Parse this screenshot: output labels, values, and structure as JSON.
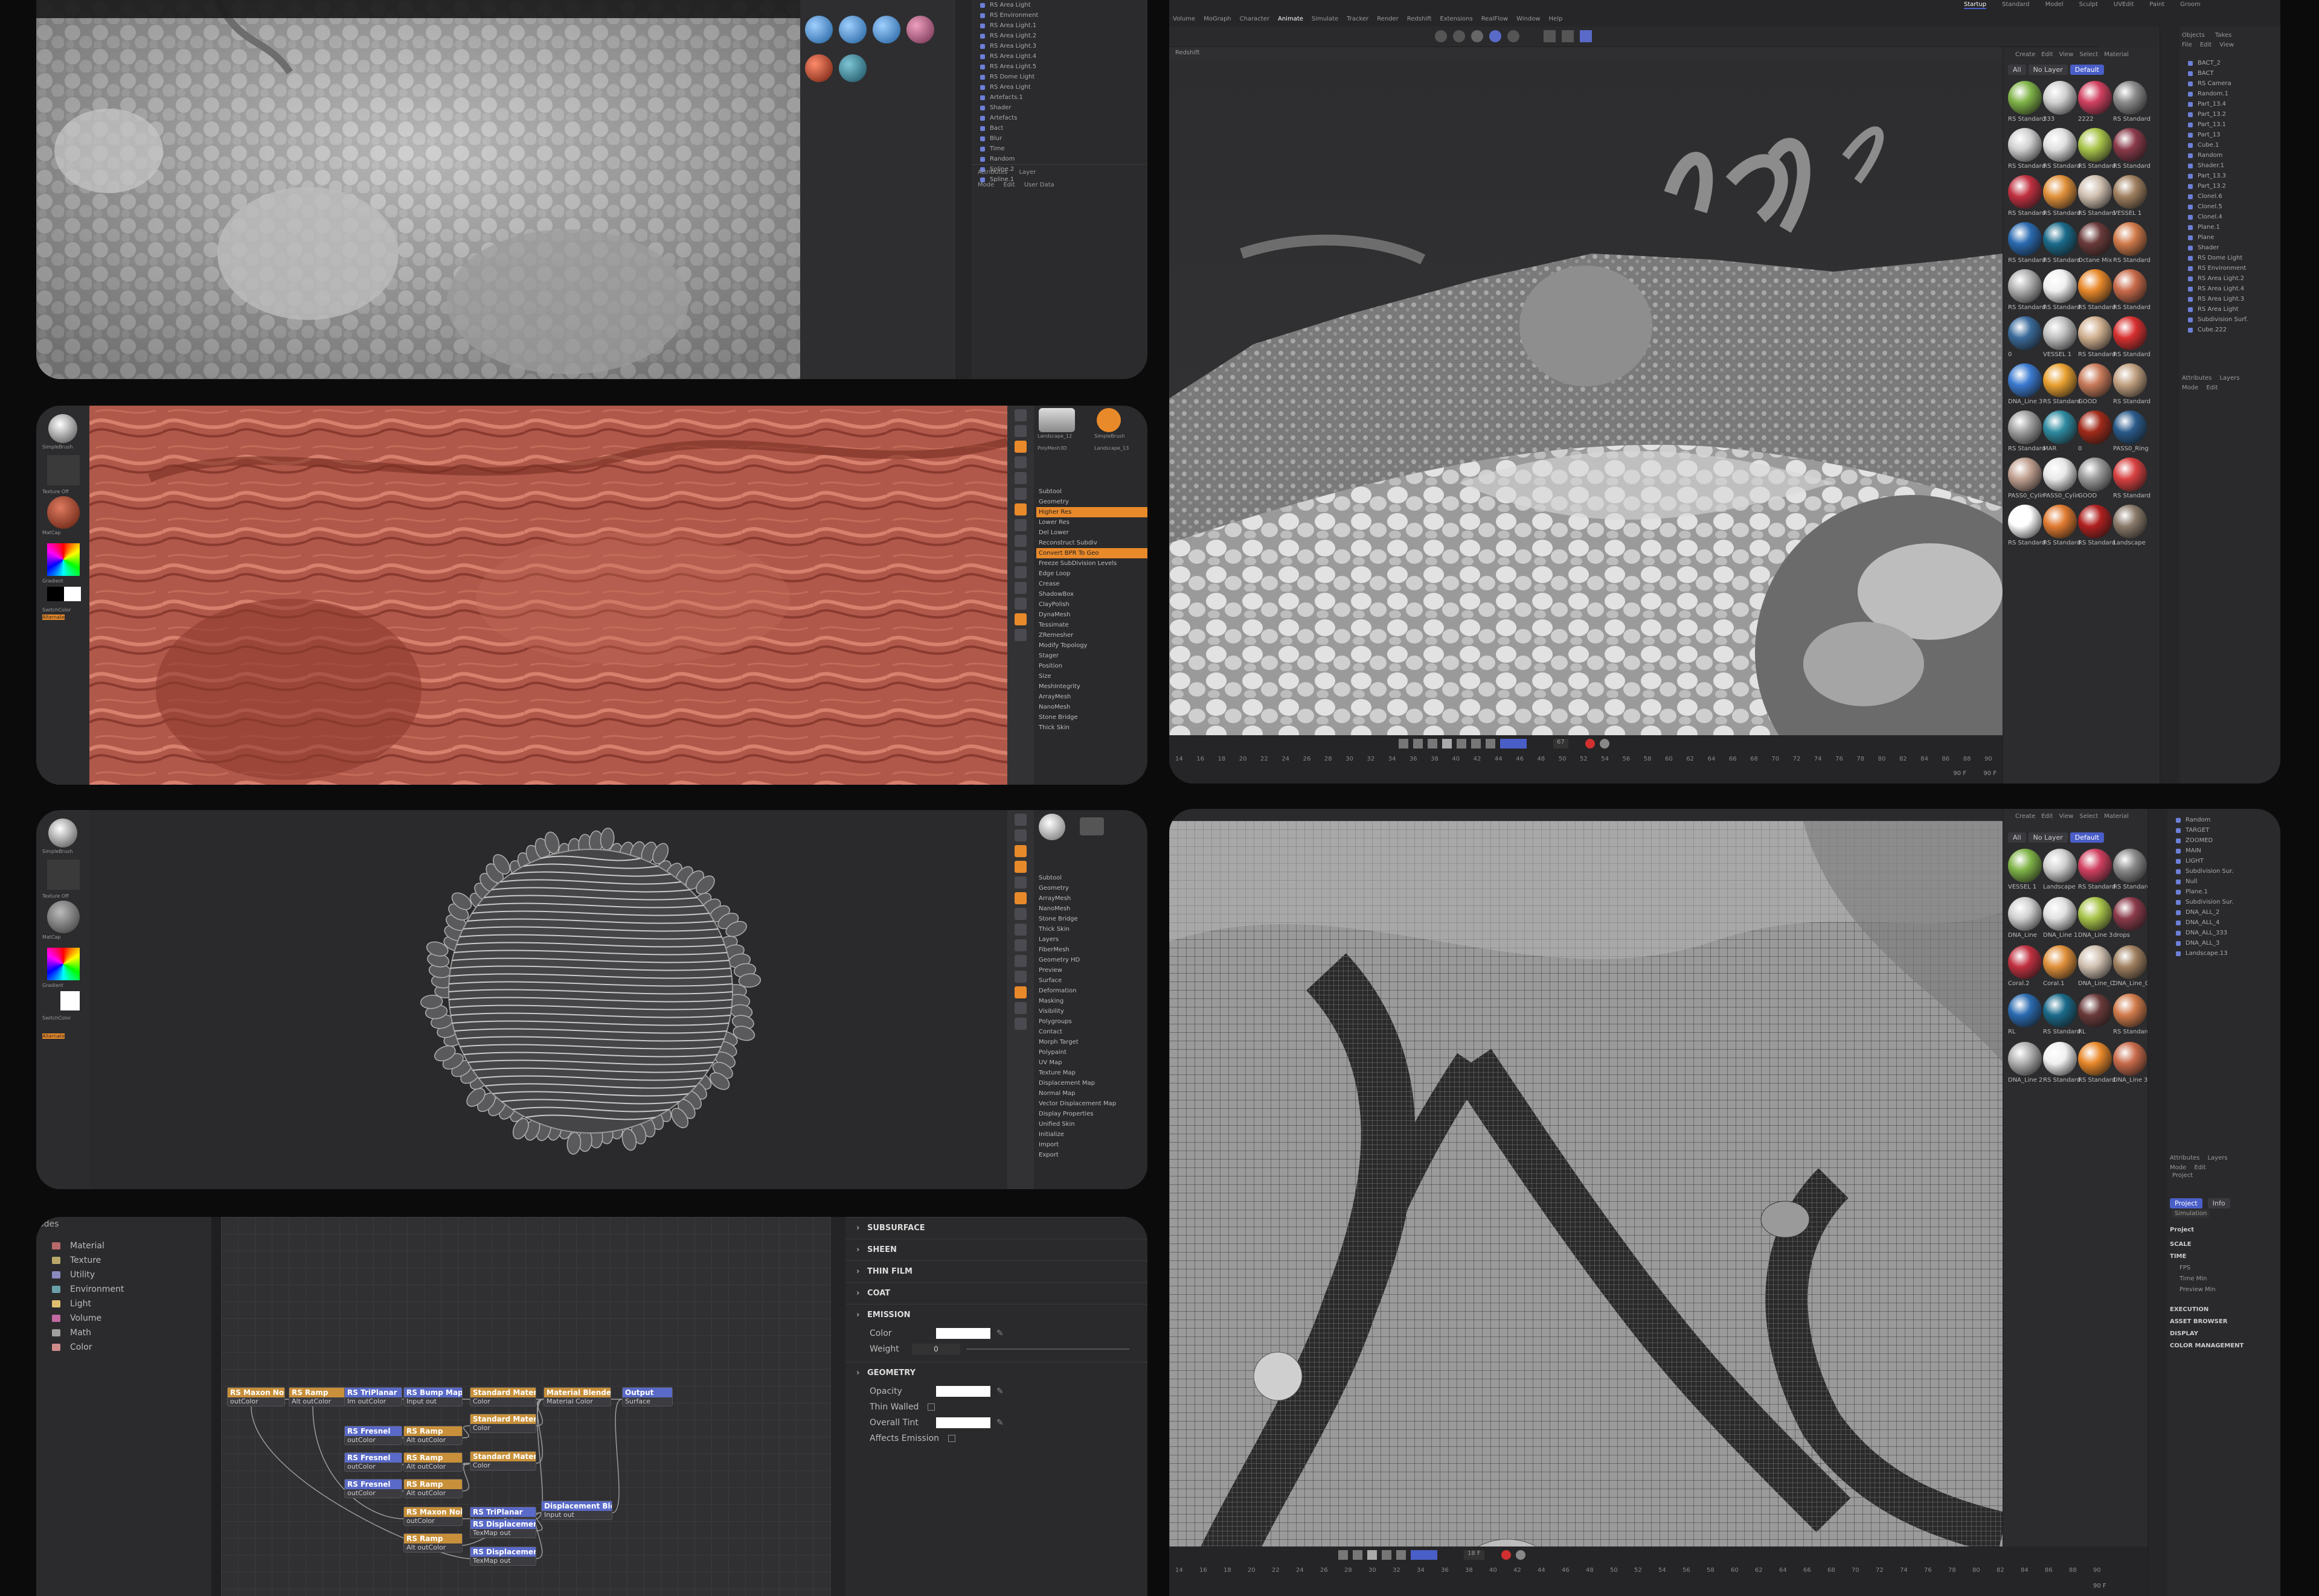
{
  "colors": {
    "accent": "#4a5ec8",
    "zbrush_orange": "#e8892a",
    "skin_red": "#b0584a",
    "viewport_gray": "#7d7d7d"
  },
  "cinema4d": {
    "menu": [
      "Volume",
      "MoGraph",
      "Character",
      "Animate",
      "Simulate",
      "Tracker",
      "Render",
      "Redshift",
      "Extensions",
      "RealFlow",
      "Window",
      "Help"
    ],
    "layouts": [
      "Startup",
      "Standard",
      "Model",
      "Sculpt",
      "UVEdit",
      "Paint",
      "Groom"
    ],
    "viewport_label": "Redshift",
    "material_menu": [
      "Create",
      "Edit",
      "View",
      "Select",
      "Material"
    ],
    "material_tabs": [
      "All",
      "No Layer",
      "Default"
    ],
    "material_labels_top": [
      "RS Standard",
      "333",
      "2222",
      "RS Standard",
      "RS Standard",
      "RS Standard",
      "RS Standard",
      "RS Standard",
      "RS Standard",
      "RS Standard",
      "RS Standard",
      "VESSEL 1",
      "RS Standard",
      "RS Standard",
      "Octane Mix",
      "RS Standard",
      "RS Standard",
      "RS Standard",
      "RS Standard",
      "RS Standard",
      "0",
      "VESSEL 1",
      "RS Standard",
      "RS Standard",
      "DNA_Line 3",
      "RS Standard",
      "GOOD",
      "RS Standard",
      "RS Standard",
      "MAR",
      "0",
      "PASS0_Ring",
      "PASS0_Cylin",
      "PASS0_Cylin",
      "GOOD",
      "RS Standard",
      "RS Standard",
      "RS Standard",
      "RS Standard",
      "Landscape"
    ],
    "objects_header": [
      "File",
      "Edit",
      "View"
    ],
    "objects_tabs": [
      "Objects",
      "Takes"
    ],
    "objects_top": [
      "BACT_2",
      "BACT",
      "RS Camera",
      "Random.1",
      "Part_13.4",
      "Part_13.2",
      "Part_13.1",
      "Part_13",
      "Cube.1",
      "Random",
      "Shader.1",
      "Part_13.3",
      "Part_13.2",
      "Clonel.6",
      "Clonel.5",
      "Clonel.4",
      "Plane.1",
      "Plane",
      "Shader",
      "RS Dome Light",
      "RS Environment",
      "RS Area Light.2",
      "RS Area Light.4",
      "RS Area Light.3",
      "RS Area Light",
      "Subdivision Surf.",
      "Cube.222"
    ],
    "attributes_tabs": [
      "Attributes",
      "Layers"
    ],
    "attributes_menu": [
      "Mode",
      "Edit"
    ],
    "timeline_top": [
      "14",
      "16",
      "18",
      "20",
      "22",
      "24",
      "26",
      "28",
      "30",
      "32",
      "34",
      "36",
      "38",
      "40",
      "42",
      "44",
      "46",
      "48",
      "50",
      "52",
      "54",
      "56",
      "58",
      "60",
      "62",
      "64",
      "66",
      "68",
      "70",
      "72",
      "74",
      "76",
      "78",
      "80",
      "82",
      "84",
      "86",
      "88",
      "90"
    ],
    "frame_value_top": "67",
    "end_frame": "90 F",
    "material_labels_bottom": [
      "VESSEL 1",
      "Landscape",
      "RS Standard",
      "RS Standard",
      "DNA_Line",
      "DNA_Line 1",
      "DNA_Line 3",
      "drops",
      "Coral.2",
      "Coral.1",
      "DNA_Line_C",
      "DNA_Line_C",
      "RL",
      "RS Standard",
      "RL",
      "RS Standard",
      "DNA_Line 2",
      "RS Standard",
      "RS Standard",
      "DNA_Line 3"
    ],
    "objects_bottom": [
      "Random",
      "TARGET",
      "ZOOMED",
      "MAIN",
      "LIGHT",
      "Subdivision Sur.",
      "Null",
      "Plane.1",
      "Subdivision Sur.",
      "DNA_ALL_2",
      "DNA_ALL_4",
      "DNA_ALL_333",
      "DNA_ALL_3",
      "Landscape.13"
    ],
    "project_tabs": [
      "Project",
      "Info"
    ],
    "project_sub": "Simulation",
    "project_heading": "Project",
    "project_sections": [
      "SCALE",
      "TIME",
      "EXECUTION",
      "ASSET BROWSER",
      "DISPLAY",
      "COLOR MANAGEMENT"
    ],
    "time_fields": [
      "FPS",
      "Time Min",
      "Preview Min"
    ],
    "project_item": "Project",
    "frame_value_bottom": "18 F"
  },
  "zbrush": {
    "swatch_labels": [
      "Brush",
      "SimpleBrush",
      "Texture Off",
      "MatCap",
      "Gradient",
      "SwitchColor",
      "Alternate"
    ],
    "tool_labels": [
      "Landscape_12",
      "SimpleBrush",
      "PolyMesh3D",
      "Landscape_13"
    ],
    "subtool_menu_top": [
      "Subtool",
      "Geometry",
      "Higher Res",
      "Lower Res",
      "Del Lower",
      "Reconstruct Subdiv",
      "Convert BPR To Geo",
      "Freeze SubDivision Levels",
      "Edge Loop",
      "Crease",
      "ShadowBox",
      "ClayPolish",
      "DynaMesh",
      "Tessimate",
      "ZRemesher",
      "Modify Topology",
      "Stager",
      "Position",
      "Size",
      "MeshIntegrity",
      "ArrayMesh",
      "NanoMesh",
      "Stone Bridge",
      "Thick Skin"
    ],
    "subtool_menu_mid": [
      "Subtool",
      "Geometry",
      "ArrayMesh",
      "NanoMesh",
      "Stone Bridge",
      "Thick Skin",
      "Layers",
      "FiberMesh",
      "Geometry HD",
      "Preview",
      "Surface",
      "Deformation",
      "Masking",
      "Visibility",
      "Polygroups",
      "Contact",
      "Morph Target",
      "Polypaint",
      "UV Map",
      "Texture Map",
      "Displacement Map",
      "Normal Map",
      "Vector Displacement Map",
      "Display Properties",
      "Unified Skin",
      "Initialize",
      "Import",
      "Export"
    ]
  },
  "objects_top_panel": {
    "items": [
      "RS Area Light",
      "RS Environment",
      "RS Area Light.1",
      "RS Area Light.2",
      "RS Area Light.3",
      "RS Area Light.4",
      "RS Area Light.5",
      "RS Dome Light",
      "RS Area Light",
      "Artefacts.1",
      "Shader",
      "Artefacts",
      "Bact",
      "Blur",
      "Time",
      "Random",
      "Spline.2",
      "Spline.1"
    ],
    "attr_tabs": [
      "Attributes",
      "Layer"
    ],
    "attr_menu": [
      "Mode",
      "Edit",
      "User Data"
    ]
  },
  "node_editor": {
    "categories": [
      {
        "label": "Material",
        "color": "#b86a6a"
      },
      {
        "label": "Texture",
        "color": "#b8a86a"
      },
      {
        "label": "Utility",
        "color": "#8a8ac0"
      },
      {
        "label": "Environment",
        "color": "#6aa0a8"
      },
      {
        "label": "Light",
        "color": "#e0c070"
      },
      {
        "label": "Volume",
        "color": "#c06aa0"
      },
      {
        "label": "Math",
        "color": "#a0a0a0"
      },
      {
        "label": "Color",
        "color": "#d08a8a"
      }
    ],
    "header": "odes",
    "nodes": [
      {
        "title": "RS Maxon Noise",
        "port": "outColor",
        "c": "#c8903a"
      },
      {
        "title": "RS Ramp",
        "port": "Alt outColor",
        "c": "#c8903a"
      },
      {
        "title": "RS TriPlanar",
        "port": "Im outColor",
        "c": "#5a6ac8"
      },
      {
        "title": "RS Bump Map",
        "port": "Input  out",
        "c": "#5a6ac8"
      },
      {
        "title": "Standard Material",
        "port": "Color",
        "c": "#c8903a"
      },
      {
        "title": "Material Blender",
        "port": "Material Color",
        "c": "#c8903a"
      },
      {
        "title": "Output",
        "port": "Surface",
        "c": "#5a6ac8"
      },
      {
        "title": "RS Fresnel",
        "port": "outColor",
        "c": "#5a6ac8"
      },
      {
        "title": "RS Ramp",
        "port": "Alt outColor",
        "c": "#c8903a"
      },
      {
        "title": "Standard Material",
        "port": "Color",
        "c": "#c8903a"
      },
      {
        "title": "RS Fresnel",
        "port": "outColor",
        "c": "#5a6ac8"
      },
      {
        "title": "RS Ramp",
        "port": "Alt outColor",
        "c": "#c8903a"
      },
      {
        "title": "RS Fresnel",
        "port": "outColor",
        "c": "#5a6ac8"
      },
      {
        "title": "RS Ramp",
        "port": "Alt outColor",
        "c": "#c8903a"
      },
      {
        "title": "Standard Material",
        "port": "Color",
        "c": "#c8903a"
      },
      {
        "title": "RS Maxon Noise",
        "port": "outColor",
        "c": "#c8903a"
      },
      {
        "title": "RS TriPlanar",
        "port": "Imau outColor",
        "c": "#5a6ac8"
      },
      {
        "title": "RS Ramp",
        "port": "Alt outColor",
        "c": "#c8903a"
      },
      {
        "title": "RS Displacement",
        "port": "TexMap  out",
        "c": "#5a6ac8"
      },
      {
        "title": "RS Displacement",
        "port": "TexMap  out",
        "c": "#5a6ac8"
      },
      {
        "title": "Displacement Blender",
        "port": "Input  out",
        "c": "#5a6ac8"
      }
    ],
    "props": {
      "sections": [
        "SUBSURFACE",
        "SHEEN",
        "THIN FILM",
        "COAT",
        "EMISSION",
        "GEOMETRY"
      ],
      "emission_color": "Color",
      "emission_weight": "Weight",
      "emission_weight_value": "0",
      "opacity": "Opacity",
      "thin_walled": "Thin Walled",
      "overall_tint": "Overall Tint",
      "affects_emission": "Affects Emission"
    }
  }
}
